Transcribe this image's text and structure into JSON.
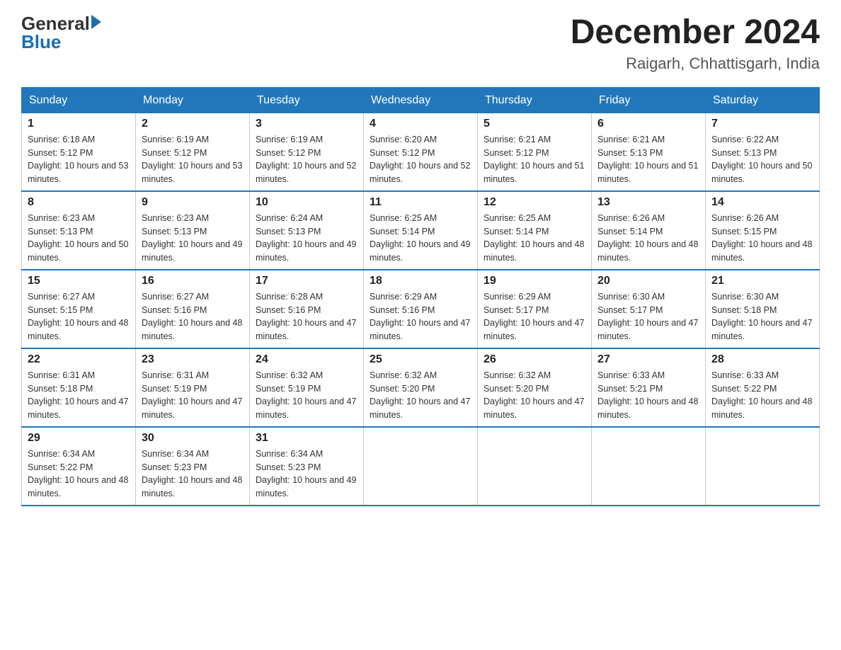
{
  "header": {
    "logo_general": "General",
    "logo_blue": "Blue",
    "month_title": "December 2024",
    "location": "Raigarh, Chhattisgarh, India"
  },
  "days_of_week": [
    "Sunday",
    "Monday",
    "Tuesday",
    "Wednesday",
    "Thursday",
    "Friday",
    "Saturday"
  ],
  "weeks": [
    [
      {
        "day": "1",
        "sunrise": "6:18 AM",
        "sunset": "5:12 PM",
        "daylight": "10 hours and 53 minutes."
      },
      {
        "day": "2",
        "sunrise": "6:19 AM",
        "sunset": "5:12 PM",
        "daylight": "10 hours and 53 minutes."
      },
      {
        "day": "3",
        "sunrise": "6:19 AM",
        "sunset": "5:12 PM",
        "daylight": "10 hours and 52 minutes."
      },
      {
        "day": "4",
        "sunrise": "6:20 AM",
        "sunset": "5:12 PM",
        "daylight": "10 hours and 52 minutes."
      },
      {
        "day": "5",
        "sunrise": "6:21 AM",
        "sunset": "5:12 PM",
        "daylight": "10 hours and 51 minutes."
      },
      {
        "day": "6",
        "sunrise": "6:21 AM",
        "sunset": "5:13 PM",
        "daylight": "10 hours and 51 minutes."
      },
      {
        "day": "7",
        "sunrise": "6:22 AM",
        "sunset": "5:13 PM",
        "daylight": "10 hours and 50 minutes."
      }
    ],
    [
      {
        "day": "8",
        "sunrise": "6:23 AM",
        "sunset": "5:13 PM",
        "daylight": "10 hours and 50 minutes."
      },
      {
        "day": "9",
        "sunrise": "6:23 AM",
        "sunset": "5:13 PM",
        "daylight": "10 hours and 49 minutes."
      },
      {
        "day": "10",
        "sunrise": "6:24 AM",
        "sunset": "5:13 PM",
        "daylight": "10 hours and 49 minutes."
      },
      {
        "day": "11",
        "sunrise": "6:25 AM",
        "sunset": "5:14 PM",
        "daylight": "10 hours and 49 minutes."
      },
      {
        "day": "12",
        "sunrise": "6:25 AM",
        "sunset": "5:14 PM",
        "daylight": "10 hours and 48 minutes."
      },
      {
        "day": "13",
        "sunrise": "6:26 AM",
        "sunset": "5:14 PM",
        "daylight": "10 hours and 48 minutes."
      },
      {
        "day": "14",
        "sunrise": "6:26 AM",
        "sunset": "5:15 PM",
        "daylight": "10 hours and 48 minutes."
      }
    ],
    [
      {
        "day": "15",
        "sunrise": "6:27 AM",
        "sunset": "5:15 PM",
        "daylight": "10 hours and 48 minutes."
      },
      {
        "day": "16",
        "sunrise": "6:27 AM",
        "sunset": "5:16 PM",
        "daylight": "10 hours and 48 minutes."
      },
      {
        "day": "17",
        "sunrise": "6:28 AM",
        "sunset": "5:16 PM",
        "daylight": "10 hours and 47 minutes."
      },
      {
        "day": "18",
        "sunrise": "6:29 AM",
        "sunset": "5:16 PM",
        "daylight": "10 hours and 47 minutes."
      },
      {
        "day": "19",
        "sunrise": "6:29 AM",
        "sunset": "5:17 PM",
        "daylight": "10 hours and 47 minutes."
      },
      {
        "day": "20",
        "sunrise": "6:30 AM",
        "sunset": "5:17 PM",
        "daylight": "10 hours and 47 minutes."
      },
      {
        "day": "21",
        "sunrise": "6:30 AM",
        "sunset": "5:18 PM",
        "daylight": "10 hours and 47 minutes."
      }
    ],
    [
      {
        "day": "22",
        "sunrise": "6:31 AM",
        "sunset": "5:18 PM",
        "daylight": "10 hours and 47 minutes."
      },
      {
        "day": "23",
        "sunrise": "6:31 AM",
        "sunset": "5:19 PM",
        "daylight": "10 hours and 47 minutes."
      },
      {
        "day": "24",
        "sunrise": "6:32 AM",
        "sunset": "5:19 PM",
        "daylight": "10 hours and 47 minutes."
      },
      {
        "day": "25",
        "sunrise": "6:32 AM",
        "sunset": "5:20 PM",
        "daylight": "10 hours and 47 minutes."
      },
      {
        "day": "26",
        "sunrise": "6:32 AM",
        "sunset": "5:20 PM",
        "daylight": "10 hours and 47 minutes."
      },
      {
        "day": "27",
        "sunrise": "6:33 AM",
        "sunset": "5:21 PM",
        "daylight": "10 hours and 48 minutes."
      },
      {
        "day": "28",
        "sunrise": "6:33 AM",
        "sunset": "5:22 PM",
        "daylight": "10 hours and 48 minutes."
      }
    ],
    [
      {
        "day": "29",
        "sunrise": "6:34 AM",
        "sunset": "5:22 PM",
        "daylight": "10 hours and 48 minutes."
      },
      {
        "day": "30",
        "sunrise": "6:34 AM",
        "sunset": "5:23 PM",
        "daylight": "10 hours and 48 minutes."
      },
      {
        "day": "31",
        "sunrise": "6:34 AM",
        "sunset": "5:23 PM",
        "daylight": "10 hours and 49 minutes."
      },
      null,
      null,
      null,
      null
    ]
  ]
}
